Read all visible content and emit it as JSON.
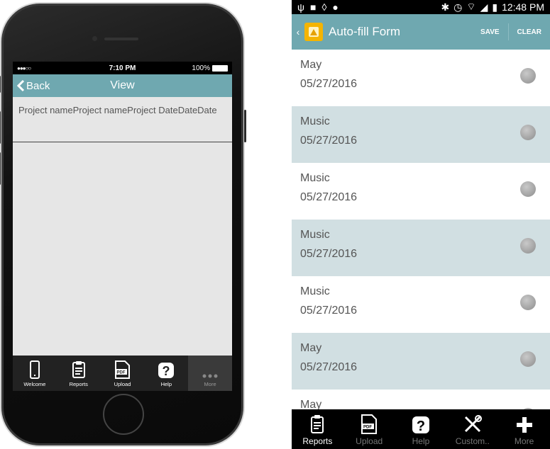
{
  "ios": {
    "status": {
      "carrier": "●●●○○",
      "time": "7:10 PM",
      "battery": "100%"
    },
    "nav": {
      "back_label": "Back",
      "title": "View"
    },
    "content": {
      "text": "Project nameProject nameProject DateDateDate"
    },
    "tabs": [
      {
        "label": "Welcome",
        "icon": "phone-icon"
      },
      {
        "label": "Reports",
        "icon": "clipboard-icon"
      },
      {
        "label": "Upload",
        "icon": "pdf-icon"
      },
      {
        "label": "Help",
        "icon": "help-icon"
      },
      {
        "label": "More",
        "icon": "more-icon"
      }
    ]
  },
  "android": {
    "status": {
      "time": "12:48 PM"
    },
    "appbar": {
      "title": "Auto-fill Form",
      "save_label": "SAVE",
      "clear_label": "CLEAR"
    },
    "items": [
      {
        "name": "May",
        "date": "05/27/2016"
      },
      {
        "name": "Music",
        "date": "05/27/2016"
      },
      {
        "name": "Music",
        "date": "05/27/2016"
      },
      {
        "name": "Music",
        "date": "05/27/2016"
      },
      {
        "name": "Music",
        "date": "05/27/2016"
      },
      {
        "name": "May",
        "date": "05/27/2016"
      },
      {
        "name": "May",
        "date": ""
      }
    ],
    "tabs": [
      {
        "label": "Reports",
        "icon": "clipboard-icon"
      },
      {
        "label": "Upload",
        "icon": "pdf-icon"
      },
      {
        "label": "Help",
        "icon": "help-icon"
      },
      {
        "label": "Custom..",
        "icon": "tools-icon"
      },
      {
        "label": "More",
        "icon": "plus-icon"
      }
    ]
  },
  "colors": {
    "accent": "#6fa8b0",
    "row_alt": "#d1dfe2",
    "app_icon": "#f4b400"
  }
}
